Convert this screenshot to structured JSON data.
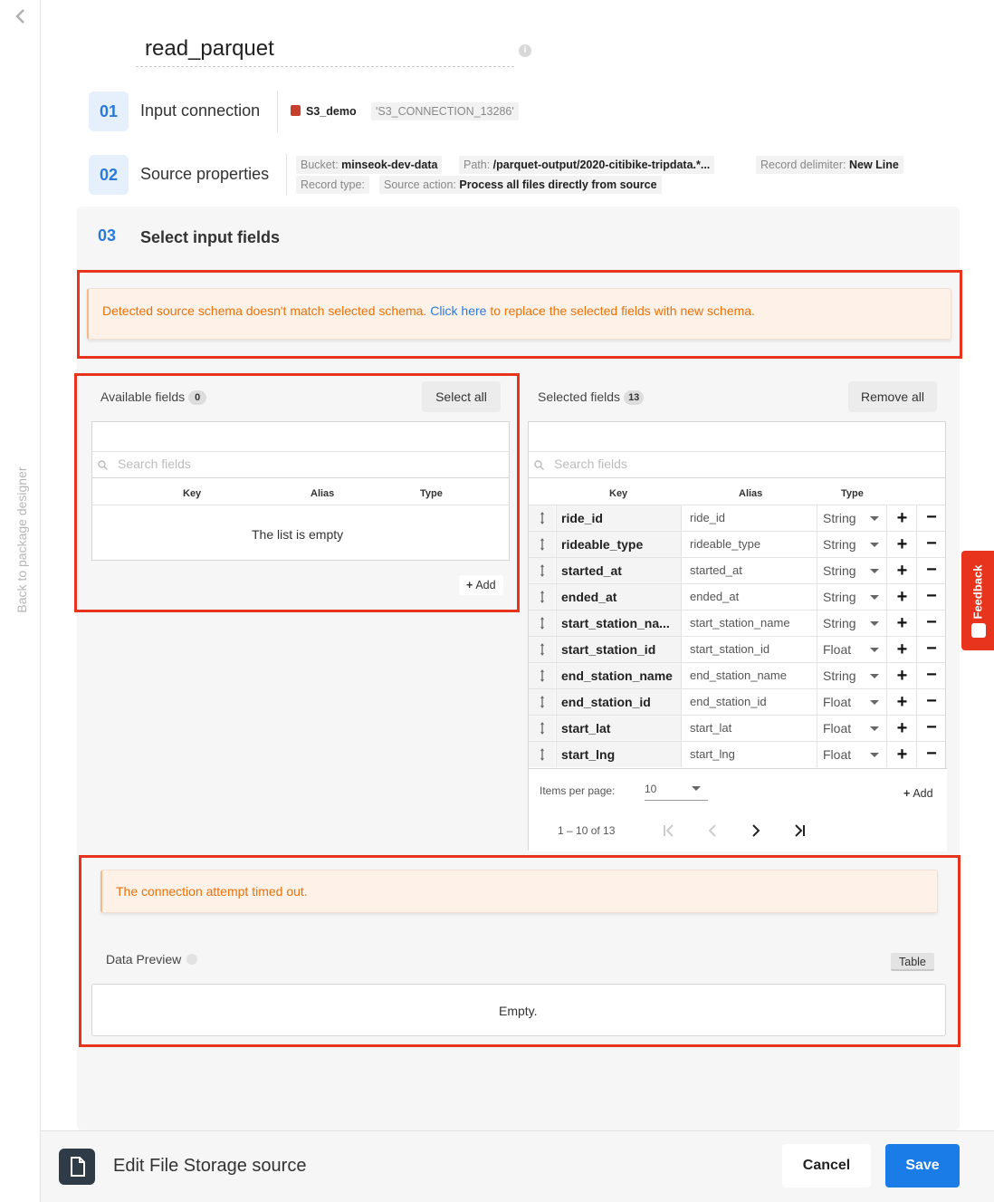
{
  "nav": {
    "back_label": "Back to package designer"
  },
  "header": {
    "title": "read_parquet"
  },
  "steps": [
    {
      "num": "01",
      "label": "Input connection"
    },
    {
      "num": "02",
      "label": "Source properties"
    },
    {
      "num": "03",
      "label": "Select input fields"
    }
  ],
  "connection": {
    "name": "S3_demo",
    "id": "'S3_CONNECTION_13286'"
  },
  "source_props": {
    "bucket_label": "Bucket:",
    "bucket_value": "minseok-dev-data",
    "path_label": "Path:",
    "path_value": "/parquet-output/2020-citibike-tripdata.*...",
    "delim_label": "Record delimiter:",
    "delim_value": "New Line",
    "rectype_label": "Record type:",
    "action_label": "Source action:",
    "action_value": "Process all files directly from source"
  },
  "schema_warning": {
    "prefix": "Detected source schema doesn't match selected schema.",
    "link": "Click here",
    "suffix": "to replace the selected fields with new schema."
  },
  "available": {
    "label": "Available fields",
    "count": "0",
    "select_all": "Select all",
    "search_placeholder": "Search fields",
    "col_key": "Key",
    "col_alias": "Alias",
    "col_type": "Type",
    "empty": "The list is empty",
    "add": "Add"
  },
  "selected": {
    "label": "Selected fields",
    "count": "13",
    "remove_all": "Remove all",
    "search_placeholder": "Search fields",
    "col_key": "Key",
    "col_alias": "Alias",
    "col_type": "Type",
    "rows": [
      {
        "key": "ride_id",
        "alias": "ride_id",
        "type": "String"
      },
      {
        "key": "rideable_type",
        "alias": "rideable_type",
        "type": "String"
      },
      {
        "key": "started_at",
        "alias": "started_at",
        "type": "String"
      },
      {
        "key": "ended_at",
        "alias": "ended_at",
        "type": "String"
      },
      {
        "key": "start_station_na...",
        "alias": "start_station_name",
        "type": "String"
      },
      {
        "key": "start_station_id",
        "alias": "start_station_id",
        "type": "Float"
      },
      {
        "key": "end_station_name",
        "alias": "end_station_name",
        "type": "String"
      },
      {
        "key": "end_station_id",
        "alias": "end_station_id",
        "type": "Float"
      },
      {
        "key": "start_lat",
        "alias": "start_lat",
        "type": "Float"
      },
      {
        "key": "start_lng",
        "alias": "start_lng",
        "type": "Float"
      }
    ],
    "items_per_page_label": "Items per page:",
    "items_per_page": "10",
    "range": "1 – 10 of 13",
    "add": "Add"
  },
  "timeout_warning": "The connection attempt timed out.",
  "preview": {
    "label": "Data Preview",
    "toggle": "Table",
    "empty": "Empty."
  },
  "feedback": "Feedback",
  "footer": {
    "title": "Edit File Storage source",
    "cancel": "Cancel",
    "save": "Save"
  },
  "colors": {
    "accent": "#1a7ce6",
    "warning_text": "#e8720c",
    "highlight_red": "#e8341c"
  }
}
